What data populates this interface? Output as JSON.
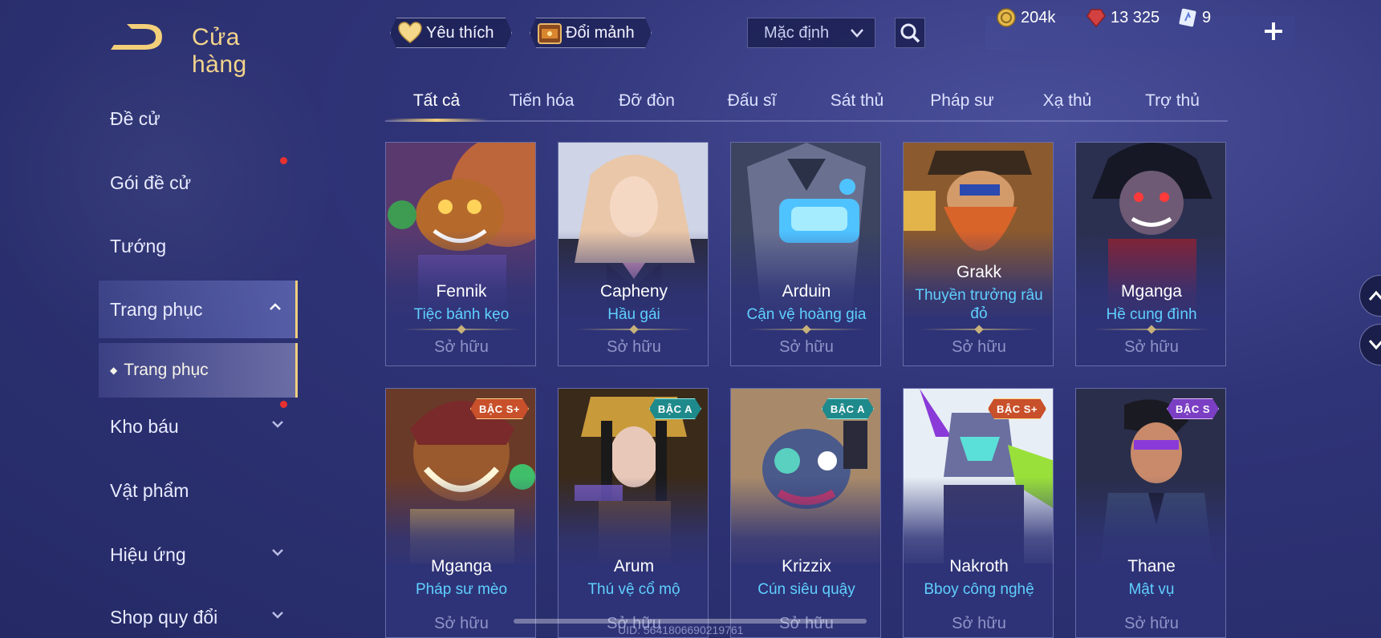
{
  "header": {
    "title": "Cửa hàng",
    "favorite_label": "Yêu thích",
    "exchange_label": "Đổi mảnh",
    "sort_value": "Mặc định"
  },
  "currency": {
    "gold": "204k",
    "gems": "13 325",
    "vouchers": "9"
  },
  "sidebar": {
    "items": [
      {
        "label": "Đề cử"
      },
      {
        "label": "Gói đề cử"
      },
      {
        "label": "Tướng"
      },
      {
        "label": "Trang phục"
      },
      {
        "label": "Kho báu"
      },
      {
        "label": "Vật phẩm"
      },
      {
        "label": "Hiệu ứng"
      },
      {
        "label": "Shop quy đổi"
      }
    ],
    "sub_item": "Trang phục"
  },
  "tabs": [
    "Tất cả",
    "Tiến hóa",
    "Đỡ đòn",
    "Đấu sĩ",
    "Sát thủ",
    "Pháp sư",
    "Xạ thủ",
    "Trợ thủ"
  ],
  "cards": [
    {
      "hero": "Fennik",
      "skin": "Tiệc bánh kẹo",
      "status": "Sở hữu",
      "tier": ""
    },
    {
      "hero": "Capheny",
      "skin": "Hầu gái",
      "status": "Sở hữu",
      "tier": ""
    },
    {
      "hero": "Arduin",
      "skin": "Cận vệ hoàng gia",
      "status": "Sở hữu",
      "tier": ""
    },
    {
      "hero": "Grakk",
      "skin": "Thuyền trưởng râu đỏ",
      "status": "Sở hữu",
      "tier": ""
    },
    {
      "hero": "Mganga",
      "skin": "Hề cung đình",
      "status": "Sở hữu",
      "tier": ""
    },
    {
      "hero": "Mganga",
      "skin": "Pháp sư mèo",
      "status": "Sở hữu",
      "tier": "BẬC S+"
    },
    {
      "hero": "Arum",
      "skin": "Thú vệ cổ mộ",
      "status": "Sở hữu",
      "tier": "BẬC A"
    },
    {
      "hero": "Krizzix",
      "skin": "Cún siêu quậy",
      "status": "Sở hữu",
      "tier": "BẬC A"
    },
    {
      "hero": "Nakroth",
      "skin": "Bboy công nghệ",
      "status": "Sở hữu",
      "tier": "BẬC S+"
    },
    {
      "hero": "Thane",
      "skin": "Mật vụ",
      "status": "Sở hữu",
      "tier": "BẬC S"
    }
  ],
  "colors": {
    "accent_gold": "#f3cf7a",
    "skin_name": "#5fd0ff",
    "tier_splus": "#c8502a",
    "tier_a": "#1f8a8c",
    "tier_s": "#7b3fc4",
    "notification": "#e8312f"
  },
  "icons": {
    "back": "back-arrow-icon",
    "favorite": "heart-icon",
    "exchange": "chest-icon",
    "search": "search-icon",
    "gold": "gold-coin-icon",
    "gems": "ruby-icon",
    "vouchers": "voucher-icon",
    "add": "plus-icon"
  },
  "footer": {
    "uid": "UID: 5641806690219761"
  }
}
